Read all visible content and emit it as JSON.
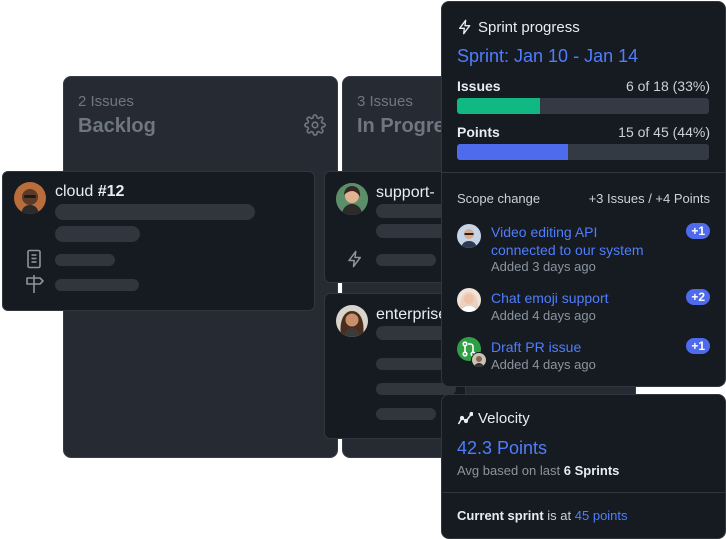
{
  "columns": [
    {
      "count": "2 Issues",
      "title": "Backlog"
    },
    {
      "count": "3 Issues",
      "title": "In Progress"
    }
  ],
  "cards": {
    "cloud": {
      "label": "cloud",
      "number": "#12"
    },
    "support": {
      "label": "support-"
    },
    "enterprise": {
      "label": "enterprise"
    }
  },
  "sprint": {
    "header": "Sprint progress",
    "name": "Sprint: Jan 10 - Jan 14",
    "issues_label": "Issues",
    "issues_value": "6 of 18 (33%)",
    "issues_fraction": 0.33,
    "points_label": "Points",
    "points_value": "15 of 45 (44%)",
    "points_fraction": 0.44,
    "scope_label": "Scope change",
    "scope_value": "+3 Issues / +4 Points",
    "items": [
      {
        "title_line1": "Video editing API",
        "title_line2": "connected to our system",
        "added": "Added 3 days ago",
        "badge": "+1"
      },
      {
        "title_line1": "Chat emoji support",
        "added": "Added 4 days ago",
        "badge": "+2"
      },
      {
        "title_line1": "Draft PR issue",
        "added": "Added 4 days ago",
        "badge": "+1"
      }
    ]
  },
  "velocity": {
    "header": "Velocity",
    "points": "42.3 Points",
    "avg_prefix": "Avg based on last",
    "avg_bold": "6 Sprints",
    "current_bold": "Current sprint",
    "current_mid": "is at",
    "current_value": "45 points"
  },
  "colors": {
    "issues_bar": "#10b981",
    "points_bar": "#4f6bed",
    "accent_text": "#4f7dff",
    "panel_bg": "#161b22"
  }
}
